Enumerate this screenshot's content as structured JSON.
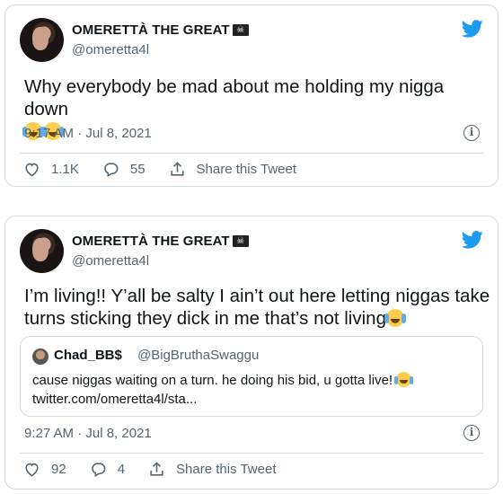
{
  "tweets": [
    {
      "name": "OMERETTÀ THE GREAT",
      "name_badge": "☠",
      "handle": "@omeretta4l",
      "text": "Why everybody be mad about me holding my nigga down",
      "emoji_count": 2,
      "emoji": "face-with-tears-of-joy",
      "timestamp": "9:17 AM · Jul 8, 2021",
      "likes": "1.1K",
      "replies": "55",
      "share_label": "Share this Tweet"
    },
    {
      "name": "OMERETTÀ THE GREAT",
      "name_badge": "☠",
      "handle": "@omeretta4l",
      "text_line1": "I’m living!! Y’all be salty I ain’t out here letting niggas take",
      "text_line2": "turns sticking they dick in me that’s not living",
      "emoji": "loudly-crying-face",
      "quote": {
        "name": "Chad_BB$",
        "handle": "@BigBruthaSwaggu",
        "text": "cause niggas waiting on a turn. he doing his bid, u gotta live!",
        "link": "twitter.com/omeretta4l/sta..."
      },
      "timestamp": "9:27 AM · Jul 8, 2021",
      "likes": "92",
      "replies": "4",
      "share_label": "Share this Tweet"
    }
  ],
  "colors": {
    "twitter_blue": "#1d9bf0",
    "secondary_text": "#536471",
    "border": "#cfd9de"
  },
  "icons": [
    "twitter-bird-icon",
    "info-icon",
    "heart-icon",
    "reply-icon",
    "share-icon"
  ]
}
